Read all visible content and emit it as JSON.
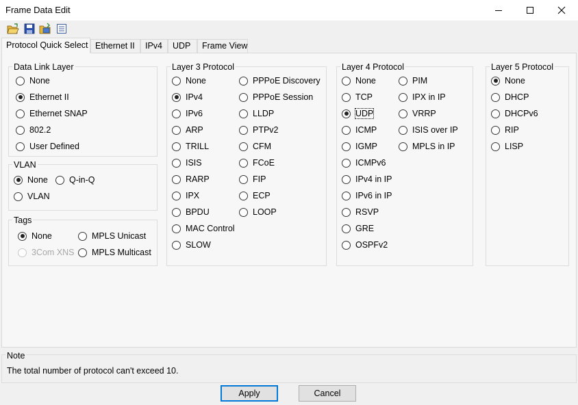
{
  "window": {
    "title": "Frame Data Edit",
    "controls": [
      "minimize-icon",
      "maximize-icon",
      "close-icon"
    ]
  },
  "toolbar": {
    "icons": [
      "open-folder-icon",
      "save-icon",
      "load-icon",
      "properties-icon"
    ]
  },
  "tabs": [
    {
      "label": "Protocol Quick Select",
      "active": true
    },
    {
      "label": "Ethernet II",
      "active": false
    },
    {
      "label": "IPv4",
      "active": false
    },
    {
      "label": "UDP",
      "active": false
    },
    {
      "label": "Frame View",
      "active": false
    }
  ],
  "groups": {
    "data_link": {
      "title": "Data Link Layer",
      "options": [
        {
          "label": "None",
          "checked": false
        },
        {
          "label": "Ethernet II",
          "checked": true
        },
        {
          "label": "Ethernet SNAP",
          "checked": false
        },
        {
          "label": "802.2",
          "checked": false
        },
        {
          "label": "User Defined",
          "checked": false
        }
      ]
    },
    "vlan": {
      "title": "VLAN",
      "options": [
        {
          "label": "None",
          "checked": true
        },
        {
          "label": "Q-in-Q",
          "checked": false
        },
        {
          "label": "VLAN",
          "checked": false
        }
      ]
    },
    "tags": {
      "title": "Tags",
      "options": [
        {
          "label": "None",
          "checked": true,
          "disabled": false
        },
        {
          "label": "MPLS Unicast",
          "checked": false,
          "disabled": false
        },
        {
          "label": "3Com XNS",
          "checked": false,
          "disabled": true
        },
        {
          "label": "MPLS Multicast",
          "checked": false,
          "disabled": false
        }
      ]
    },
    "layer3": {
      "title": "Layer 3 Protocol",
      "col1": [
        {
          "label": "None",
          "checked": false
        },
        {
          "label": "IPv4",
          "checked": true
        },
        {
          "label": "IPv6",
          "checked": false
        },
        {
          "label": "ARP",
          "checked": false
        },
        {
          "label": "TRILL",
          "checked": false
        },
        {
          "label": "ISIS",
          "checked": false
        },
        {
          "label": "RARP",
          "checked": false
        },
        {
          "label": "IPX",
          "checked": false
        },
        {
          "label": "BPDU",
          "checked": false
        },
        {
          "label": "MAC Control",
          "checked": false
        },
        {
          "label": "SLOW",
          "checked": false
        }
      ],
      "col2": [
        {
          "label": "PPPoE Discovery",
          "checked": false
        },
        {
          "label": "PPPoE Session",
          "checked": false
        },
        {
          "label": "LLDP",
          "checked": false
        },
        {
          "label": "PTPv2",
          "checked": false
        },
        {
          "label": "CFM",
          "checked": false
        },
        {
          "label": "FCoE",
          "checked": false
        },
        {
          "label": "FIP",
          "checked": false
        },
        {
          "label": "ECP",
          "checked": false
        },
        {
          "label": "LOOP",
          "checked": false
        }
      ]
    },
    "layer4": {
      "title": "Layer 4 Protocol",
      "col1": [
        {
          "label": "None",
          "checked": false
        },
        {
          "label": "TCP",
          "checked": false
        },
        {
          "label": "UDP",
          "checked": true,
          "focused": true
        },
        {
          "label": "ICMP",
          "checked": false
        },
        {
          "label": "IGMP",
          "checked": false
        },
        {
          "label": "ICMPv6",
          "checked": false
        },
        {
          "label": "IPv4 in IP",
          "checked": false
        },
        {
          "label": "IPv6 in IP",
          "checked": false
        },
        {
          "label": "RSVP",
          "checked": false
        },
        {
          "label": "GRE",
          "checked": false
        },
        {
          "label": "OSPFv2",
          "checked": false
        }
      ],
      "col2": [
        {
          "label": "PIM",
          "checked": false
        },
        {
          "label": "IPX in IP",
          "checked": false
        },
        {
          "label": "VRRP",
          "checked": false
        },
        {
          "label": "ISIS over IP",
          "checked": false
        },
        {
          "label": "MPLS in IP",
          "checked": false
        }
      ]
    },
    "layer5": {
      "title": "Layer 5 Protocol",
      "options": [
        {
          "label": "None",
          "checked": true
        },
        {
          "label": "DHCP",
          "checked": false
        },
        {
          "label": "DHCPv6",
          "checked": false
        },
        {
          "label": "RIP",
          "checked": false
        },
        {
          "label": "LISP",
          "checked": false
        }
      ]
    }
  },
  "note": {
    "title": "Note",
    "text": "The total number of protocol can't exceed 10."
  },
  "buttons": {
    "apply": "Apply",
    "cancel": "Cancel"
  }
}
